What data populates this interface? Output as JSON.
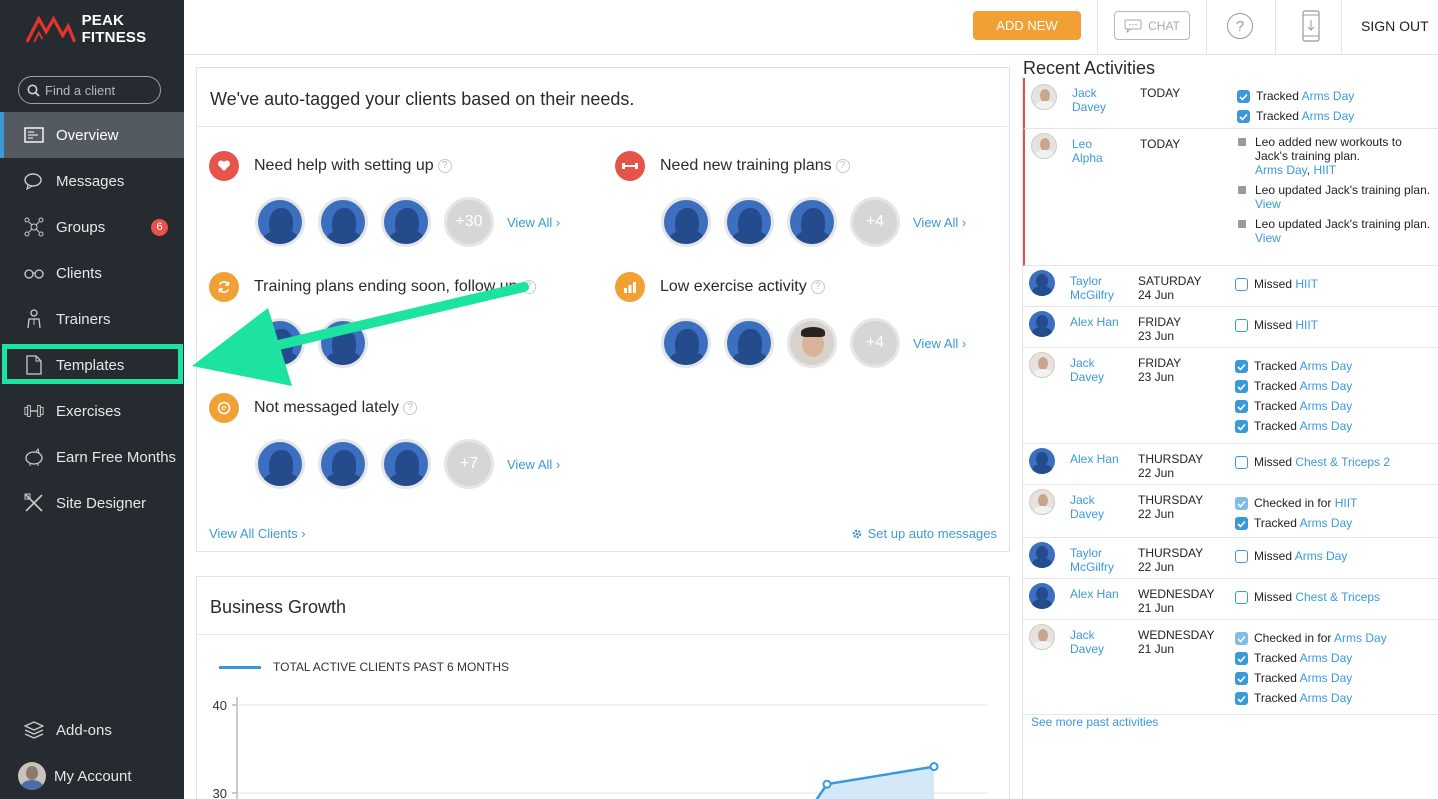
{
  "brand": {
    "name": "PEAK FITNESS",
    "logo_color": "#e5342b"
  },
  "search": {
    "placeholder": "Find a client"
  },
  "nav": [
    {
      "label": "Overview",
      "icon": "overview-icon",
      "active": true
    },
    {
      "label": "Messages",
      "icon": "messages-icon"
    },
    {
      "label": "Groups",
      "icon": "groups-icon",
      "badge": "6"
    },
    {
      "label": "Clients",
      "icon": "clients-icon"
    },
    {
      "label": "Trainers",
      "icon": "trainers-icon"
    },
    {
      "label": "Templates",
      "icon": "templates-icon"
    },
    {
      "label": "Exercises",
      "icon": "exercises-icon"
    },
    {
      "label": "Earn Free Months",
      "icon": "piggy-bank-icon"
    },
    {
      "label": "Site Designer",
      "icon": "site-designer-icon"
    }
  ],
  "nav_bottom": [
    {
      "label": "Add-ons",
      "icon": "addons-icon"
    },
    {
      "label": "My Account",
      "icon": "account-avatar"
    }
  ],
  "topbar": {
    "add_new": "ADD NEW",
    "chat": "CHAT",
    "help": "?",
    "sign_out": "SIGN OUT"
  },
  "autotag": {
    "title": "We've auto-tagged your clients based on their needs.",
    "groups": [
      {
        "title": "Need help with setting up",
        "more": "+30",
        "view_all": "View All",
        "color": "#e5534b"
      },
      {
        "title": "Need new training plans",
        "more": "+4",
        "view_all": "View All",
        "color": "#e5534b"
      },
      {
        "title": "Training plans ending soon, follow up",
        "color": "#f0a034"
      },
      {
        "title": "Low exercise activity",
        "more": "+4",
        "view_all": "View All",
        "color": "#f0a034"
      },
      {
        "title": "Not messaged lately",
        "more": "+7",
        "view_all": "View All",
        "color": "#f0a034"
      }
    ],
    "view_all_clients": "View All Clients",
    "setup_auto_messages": "Set up auto messages"
  },
  "growth": {
    "title": "Business Growth",
    "legend": "TOTAL ACTIVE CLIENTS PAST 6 MONTHS",
    "line_color": "#3a9ad9"
  },
  "chart_data": {
    "type": "area",
    "title": "Business Growth",
    "series": [
      {
        "name": "TOTAL ACTIVE CLIENTS PAST 6 MONTHS",
        "values": [
          29,
          31,
          33
        ]
      }
    ],
    "ytick_labels": [
      "40",
      "30"
    ],
    "grid": true
  },
  "activities": {
    "title": "Recent Activities",
    "see_more": "See more past activities",
    "rows": [
      {
        "name1": "Jack",
        "name2": "Davey",
        "date1": "TODAY",
        "date2": "",
        "photo": true,
        "highlight": true,
        "acts": [
          {
            "type": "checked",
            "text": "Tracked ",
            "link": "Arms Day"
          },
          {
            "type": "checked",
            "text": "Tracked ",
            "link": "Arms Day"
          }
        ]
      },
      {
        "name1": "Leo",
        "name2": "Alpha",
        "date1": "TODAY",
        "date2": "",
        "photo": true,
        "highlight": true
      },
      {
        "name1": "Taylor",
        "name2": "McGilfry",
        "date1": "SATURDAY",
        "date2": "24 Jun",
        "acts": [
          {
            "type": "empty",
            "text": "Missed ",
            "link": "HIIT"
          }
        ]
      },
      {
        "name1": "Alex Han",
        "name2": "",
        "date1": "FRIDAY",
        "date2": "23 Jun",
        "acts": [
          {
            "type": "empty",
            "text": "Missed ",
            "link": "HIIT"
          }
        ]
      },
      {
        "name1": "Jack",
        "name2": "Davey",
        "date1": "FRIDAY",
        "date2": "23 Jun",
        "photo": true,
        "acts": [
          {
            "type": "checked",
            "text": "Tracked ",
            "link": "Arms Day"
          },
          {
            "type": "checked",
            "text": "Tracked ",
            "link": "Arms Day"
          },
          {
            "type": "checked",
            "text": "Tracked ",
            "link": "Arms Day"
          },
          {
            "type": "checked",
            "text": "Tracked ",
            "link": "Arms Day"
          }
        ]
      },
      {
        "name1": "Alex Han",
        "name2": "",
        "date1": "THURSDAY",
        "date2": "22 Jun",
        "acts": [
          {
            "type": "empty",
            "text": "Missed ",
            "link": "Chest & Triceps 2"
          }
        ]
      },
      {
        "name1": "Jack",
        "name2": "Davey",
        "date1": "THURSDAY",
        "date2": "22 Jun",
        "photo": true,
        "acts": [
          {
            "type": "checkin",
            "text": "Checked in for ",
            "link": "HIIT"
          },
          {
            "type": "checked",
            "text": "Tracked ",
            "link": "Arms Day"
          }
        ]
      },
      {
        "name1": "Taylor",
        "name2": "McGilfry",
        "date1": "THURSDAY",
        "date2": "22 Jun",
        "acts": [
          {
            "type": "empty",
            "text": "Missed ",
            "link": "Arms Day"
          }
        ]
      },
      {
        "name1": "Alex Han",
        "name2": "",
        "date1": "WEDNESDAY",
        "date2": "21 Jun",
        "acts": [
          {
            "type": "empty",
            "text": "Missed ",
            "link": "Chest & Triceps"
          }
        ]
      },
      {
        "name1": "Jack",
        "name2": "Davey",
        "date1": "WEDNESDAY",
        "date2": "21 Jun",
        "photo": true,
        "acts": [
          {
            "type": "checkin",
            "text": "Checked in for ",
            "link": "Arms Day"
          },
          {
            "type": "checked",
            "text": "Tracked ",
            "link": "Arms Day"
          },
          {
            "type": "checked",
            "text": "Tracked ",
            "link": "Arms Day"
          },
          {
            "type": "checked",
            "text": "Tracked ",
            "link": "Arms Day"
          }
        ]
      }
    ],
    "leo": {
      "a1": "Leo added new workouts to Jack's training plan.",
      "a1_link1": "Arms Day",
      "a1_sep": ", ",
      "a1_link2": "HIIT",
      "a2": "Leo updated Jack's training plan. ",
      "a2_link": "View",
      "a3": "Leo updated Jack's training plan. ",
      "a3_link": "View"
    }
  },
  "annotation": {
    "color": "#1de3a0"
  }
}
